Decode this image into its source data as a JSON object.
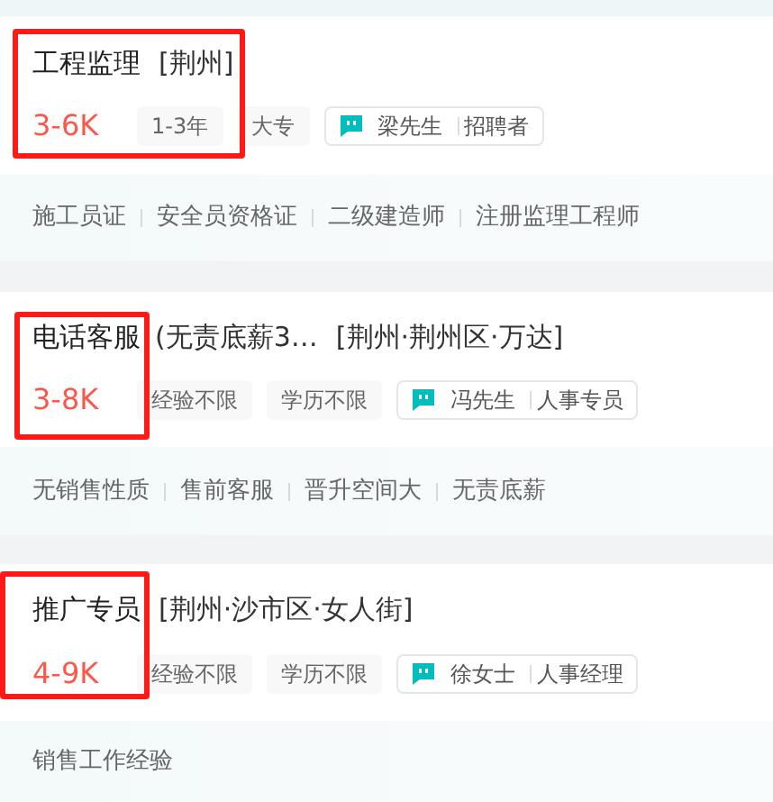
{
  "jobs": [
    {
      "title": "工程监理",
      "location": "[荆州]",
      "salary": "3-6K",
      "tags": [
        "1-3年",
        "大专"
      ],
      "recruiter": "梁先生",
      "recruiter_role": "招聘者",
      "skills": [
        "施工员证",
        "安全员资格证",
        "二级建造师",
        "注册监理工程师"
      ],
      "highlighted": true
    },
    {
      "title": "电话客服",
      "title_extra": "(无责底薪3…",
      "location": "[荆州·荆州区·万达]",
      "salary": "3-8K",
      "tags": [
        "经验不限",
        "学历不限"
      ],
      "recruiter": "冯先生",
      "recruiter_role": "人事专员",
      "skills": [
        "无销售性质",
        "售前客服",
        "晋升空间大",
        "无责底薪"
      ],
      "highlighted": true
    },
    {
      "title": "推广专员",
      "location": "[荆州·沙市区·女人街]",
      "salary": "4-9K",
      "tags": [
        "经验不限",
        "学历不限"
      ],
      "recruiter": "徐女士",
      "recruiter_role": "人事经理",
      "skills": [
        "销售工作经验"
      ],
      "highlighted": true
    }
  ]
}
